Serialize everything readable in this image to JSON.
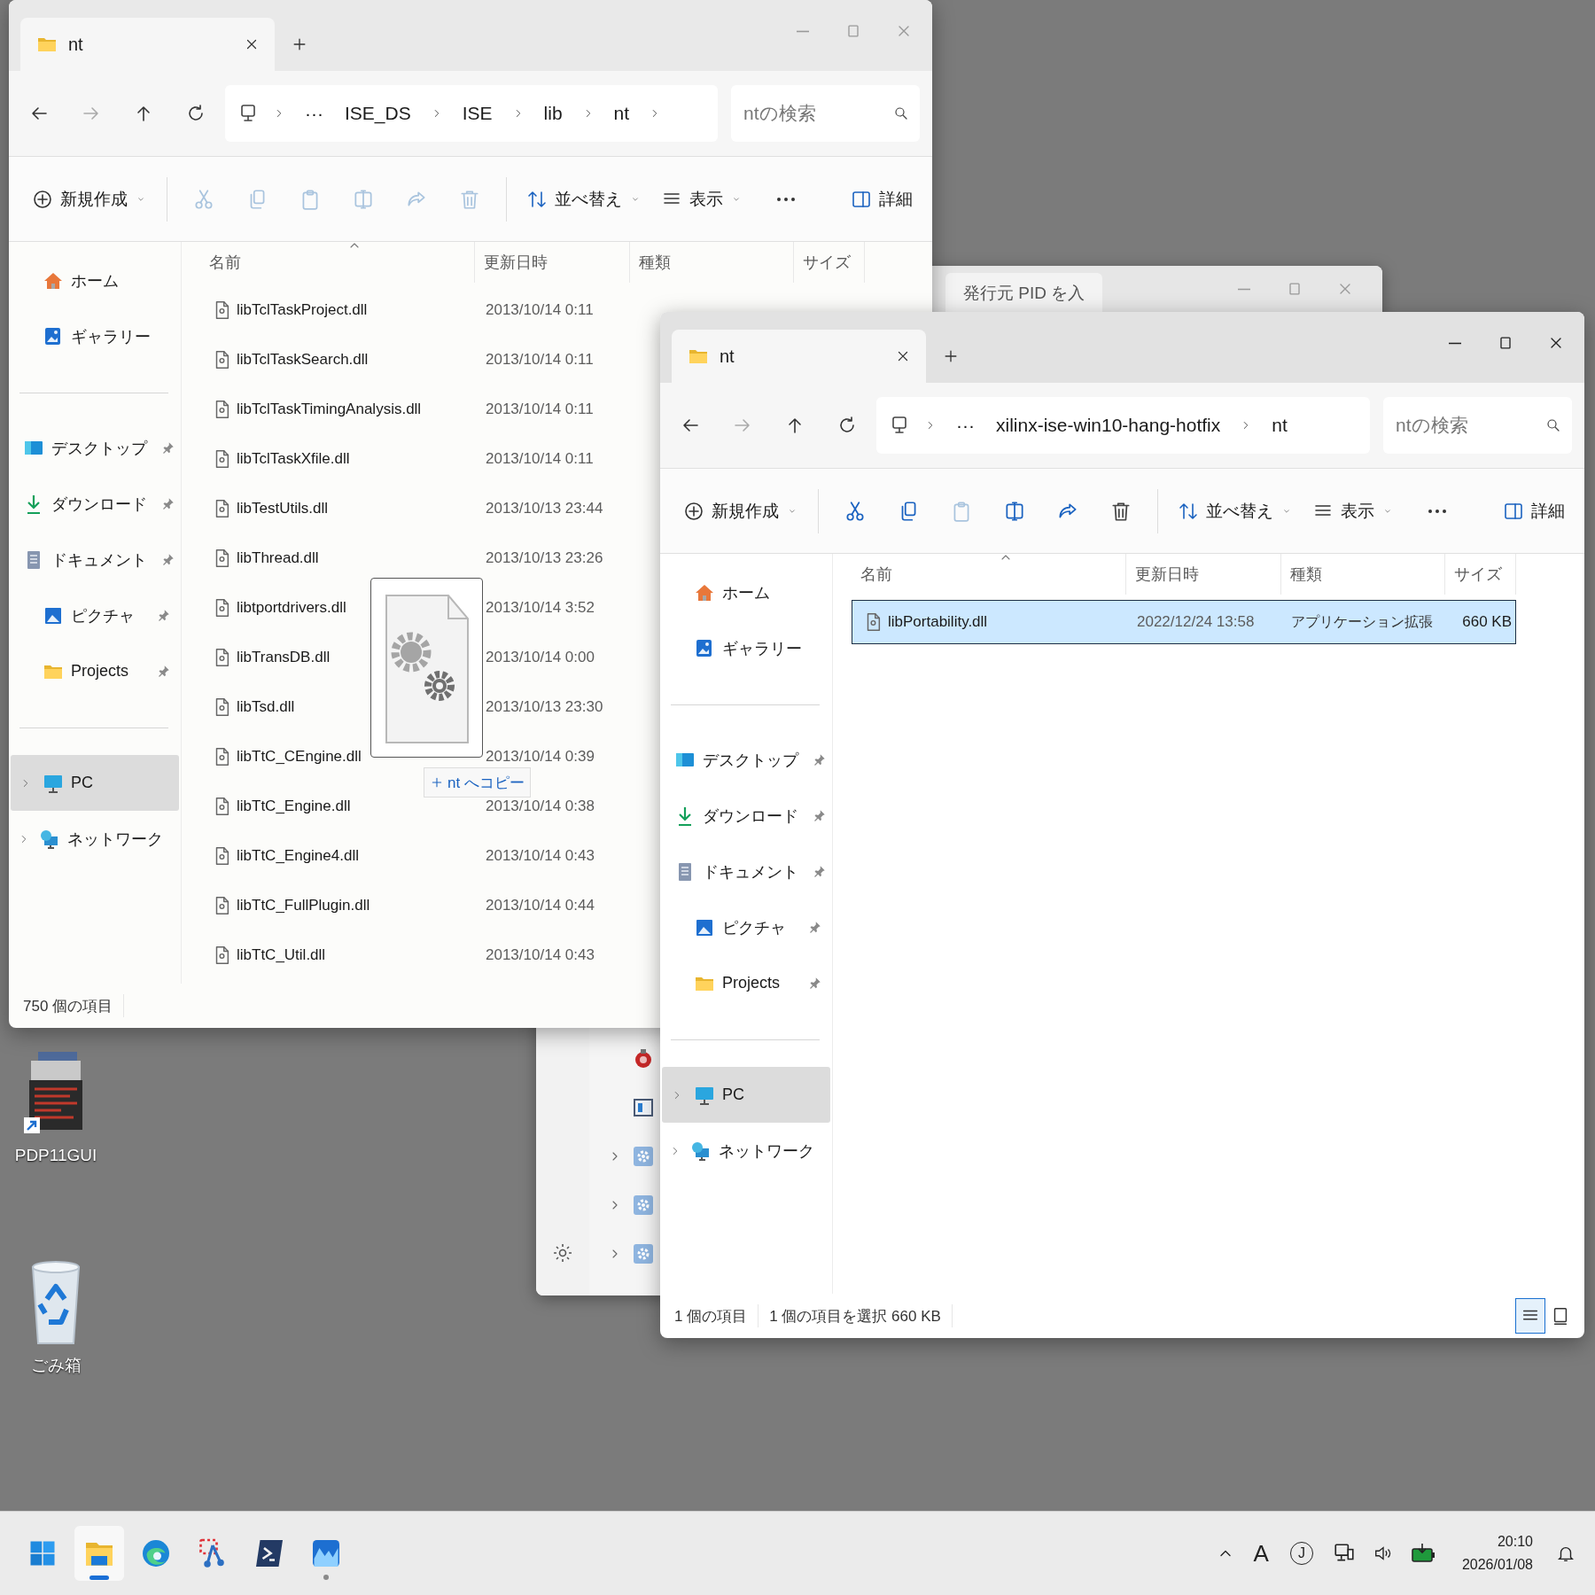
{
  "desktop_icons": [
    {
      "label": "PDP11GUI",
      "kind": "app",
      "shortcut": true
    },
    {
      "label": "ごみ箱",
      "kind": "recycle-bin",
      "shortcut": false
    }
  ],
  "background_window": {
    "tab": "発行元 PID を入"
  },
  "windows": [
    {
      "active": false,
      "tab": "nt",
      "path_overflow": "···",
      "breadcrumb": [
        "ISE_DS",
        "ISE",
        "lib",
        "nt"
      ],
      "trailing_chevron": true,
      "search": {
        "placeholder": "ntの検索"
      },
      "nav": [
        {
          "kind": "back",
          "disabled": false
        },
        {
          "kind": "forward",
          "disabled": true
        },
        {
          "kind": "up",
          "disabled": false
        },
        {
          "kind": "refresh",
          "disabled": false
        }
      ],
      "new_label": "新規作成",
      "actions": [
        {
          "kind": "cut",
          "disabled": true
        },
        {
          "kind": "copy",
          "disabled": true
        },
        {
          "kind": "paste",
          "disabled": true
        },
        {
          "kind": "rename",
          "disabled": true
        },
        {
          "kind": "share",
          "disabled": true
        },
        {
          "kind": "delete",
          "disabled": true
        }
      ],
      "sort_label": "並べ替え",
      "view_label": "表示",
      "details_label": "詳細",
      "sidebar": [
        [
          {
            "label": "ホーム",
            "kind": "home",
            "pinned": false,
            "expandable": false,
            "selected": false
          },
          {
            "label": "ギャラリー",
            "kind": "gallery",
            "pinned": false,
            "expandable": false,
            "selected": false
          }
        ],
        [
          {
            "label": "デスクトップ",
            "kind": "desktop",
            "pinned": true,
            "expandable": false,
            "selected": false
          },
          {
            "label": "ダウンロード",
            "kind": "download",
            "pinned": true,
            "expandable": false,
            "selected": false
          },
          {
            "label": "ドキュメント",
            "kind": "documents",
            "pinned": true,
            "expandable": false,
            "selected": false
          },
          {
            "label": "ピクチャ",
            "kind": "pictures",
            "pinned": true,
            "expandable": false,
            "selected": false
          },
          {
            "label": "Projects",
            "kind": "folder",
            "pinned": true,
            "expandable": false,
            "selected": false
          }
        ],
        [
          {
            "label": "PC",
            "kind": "pc",
            "pinned": false,
            "expandable": true,
            "selected": true
          },
          {
            "label": "ネットワーク",
            "kind": "network",
            "pinned": false,
            "expandable": true,
            "selected": false
          }
        ]
      ],
      "columns": [
        "名前",
        "更新日時",
        "種類",
        "サイズ"
      ],
      "rows": [
        {
          "name": "libTclTaskProject.dll",
          "modified": "2013/10/14 0:11",
          "selected": false
        },
        {
          "name": "libTclTaskSearch.dll",
          "modified": "2013/10/14 0:11",
          "selected": false
        },
        {
          "name": "libTclTaskTimingAnalysis.dll",
          "modified": "2013/10/14 0:11",
          "selected": false
        },
        {
          "name": "libTclTaskXfile.dll",
          "modified": "2013/10/14 0:11",
          "selected": false
        },
        {
          "name": "libTestUtils.dll",
          "modified": "2013/10/13 23:44",
          "selected": false
        },
        {
          "name": "libThread.dll",
          "modified": "2013/10/13 23:26",
          "selected": false
        },
        {
          "name": "libtportdrivers.dll",
          "modified": "2013/10/14 3:52",
          "selected": false
        },
        {
          "name": "libTransDB.dll",
          "modified": "2013/10/14 0:00",
          "selected": false
        },
        {
          "name": "libTsd.dll",
          "modified": "2013/10/13 23:30",
          "selected": false
        },
        {
          "name": "libTtC_CEngine.dll",
          "modified": "2013/10/14 0:39",
          "selected": false
        },
        {
          "name": "libTtC_Engine.dll",
          "modified": "2013/10/14 0:38",
          "selected": false
        },
        {
          "name": "libTtC_Engine4.dll",
          "modified": "2013/10/14 0:43",
          "selected": false
        },
        {
          "name": "libTtC_FullPlugin.dll",
          "modified": "2013/10/14 0:44",
          "selected": false
        },
        {
          "name": "libTtC_Util.dll",
          "modified": "2013/10/14 0:43",
          "selected": false
        }
      ],
      "status": [
        "750 個の項目"
      ]
    },
    {
      "active": true,
      "tab": "nt",
      "path_overflow": "···",
      "breadcrumb": [
        "xilinx-ise-win10-hang-hotfix",
        "nt"
      ],
      "trailing_chevron": false,
      "search": {
        "placeholder": "ntの検索"
      },
      "nav": [
        {
          "kind": "back",
          "disabled": false
        },
        {
          "kind": "forward",
          "disabled": true
        },
        {
          "kind": "up",
          "disabled": false
        },
        {
          "kind": "refresh",
          "disabled": false
        }
      ],
      "new_label": "新規作成",
      "actions": [
        {
          "kind": "cut",
          "disabled": false
        },
        {
          "kind": "copy",
          "disabled": false
        },
        {
          "kind": "paste",
          "disabled": true
        },
        {
          "kind": "rename",
          "disabled": false
        },
        {
          "kind": "share",
          "disabled": false
        },
        {
          "kind": "delete",
          "disabled": false
        }
      ],
      "sort_label": "並べ替え",
      "view_label": "表示",
      "details_label": "詳細",
      "sidebar": [
        [
          {
            "label": "ホーム",
            "kind": "home",
            "pinned": false,
            "expandable": false,
            "selected": false
          },
          {
            "label": "ギャラリー",
            "kind": "gallery",
            "pinned": false,
            "expandable": false,
            "selected": false
          }
        ],
        [
          {
            "label": "デスクトップ",
            "kind": "desktop",
            "pinned": true,
            "expandable": false,
            "selected": false
          },
          {
            "label": "ダウンロード",
            "kind": "download",
            "pinned": true,
            "expandable": false,
            "selected": false
          },
          {
            "label": "ドキュメント",
            "kind": "documents",
            "pinned": true,
            "expandable": false,
            "selected": false
          },
          {
            "label": "ピクチャ",
            "kind": "pictures",
            "pinned": true,
            "expandable": false,
            "selected": false
          },
          {
            "label": "Projects",
            "kind": "folder",
            "pinned": true,
            "expandable": false,
            "selected": false
          }
        ],
        [
          {
            "label": "PC",
            "kind": "pc",
            "pinned": false,
            "expandable": true,
            "selected": true
          },
          {
            "label": "ネットワーク",
            "kind": "network",
            "pinned": false,
            "expandable": true,
            "selected": false
          }
        ]
      ],
      "columns": [
        "名前",
        "更新日時",
        "種類",
        "サイズ"
      ],
      "rows": [
        {
          "name": "libPortability.dll",
          "modified": "2022/12/24 13:58",
          "type": "アプリケーション拡張",
          "size": "660 KB",
          "selected": true
        }
      ],
      "status": [
        "1 個の項目",
        "1 個の項目を選択 660 KB"
      ],
      "view_modes": [
        {
          "kind": "details",
          "selected": true
        },
        {
          "kind": "tiles",
          "selected": false
        }
      ]
    }
  ],
  "drag": {
    "label": "nt へコピー"
  },
  "taskbar": {
    "apps": [
      {
        "kind": "start",
        "active": false,
        "running": false
      },
      {
        "kind": "explorer",
        "active": true,
        "running": true
      },
      {
        "kind": "browser",
        "active": false,
        "running": false
      },
      {
        "kind": "snipping",
        "active": false,
        "running": false
      },
      {
        "kind": "terminal",
        "active": false,
        "running": false
      },
      {
        "kind": "chart",
        "active": false,
        "running": true
      }
    ],
    "ime": [
      "A",
      "J"
    ],
    "time": "20:10",
    "date": "2026/01/08"
  }
}
